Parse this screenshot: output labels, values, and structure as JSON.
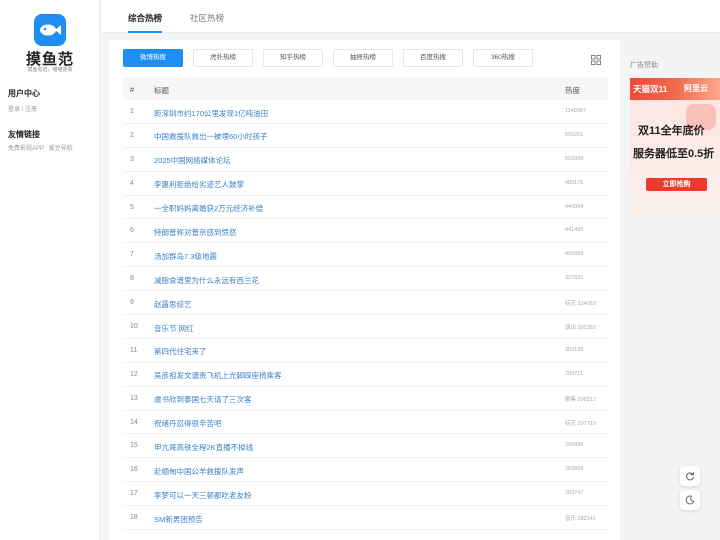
{
  "brand": {
    "name": "摸鱼范",
    "tagline": "摸鱼有范，喵喵更高"
  },
  "sidebar": {
    "user_center": "用户中心",
    "login": "登录",
    "separator": "/",
    "register": "注册",
    "links_title": "友情链接",
    "links": [
      "免费影视APP",
      "爱豆导航"
    ]
  },
  "top_tabs": [
    {
      "label": "综合热榜",
      "active": true
    },
    {
      "label": "社区热榜",
      "active": false
    }
  ],
  "source_tabs": [
    {
      "label": "微博热搜",
      "active": true
    },
    {
      "label": "虎扑热榜",
      "active": false
    },
    {
      "label": "知乎热榜",
      "active": false
    },
    {
      "label": "抽屉热榜",
      "active": false
    },
    {
      "label": "百度热搜",
      "active": false
    },
    {
      "label": "360热搜",
      "active": false
    }
  ],
  "table": {
    "headers": {
      "num": "#",
      "title": "标题",
      "heat": "热度"
    },
    "rows": [
      {
        "num": "1",
        "title": "距深圳市约170公里发现1亿吨油田",
        "heat": "1140387"
      },
      {
        "num": "2",
        "title": "中国救援队救出一被埋60小时孩子",
        "heat": "599201"
      },
      {
        "num": "3",
        "title": "2025中国网络媒体论坛",
        "heat": "502009"
      },
      {
        "num": "4",
        "title": "李惠利拒绝给劣迹艺人鼓掌",
        "heat": "485176"
      },
      {
        "num": "5",
        "title": "一全职妈妈离婚获2万元经济补偿",
        "heat": "444364"
      },
      {
        "num": "6",
        "title": "特朗普称对普京感到愤怒",
        "heat": "441455"
      },
      {
        "num": "7",
        "title": "汤加群岛7.3级地震",
        "heat": "405668"
      },
      {
        "num": "8",
        "title": "减脂食谱里为什么永远有西兰花",
        "heat": "327831"
      },
      {
        "num": "9",
        "title": "赵露思综艺",
        "heat": "综艺 314063"
      },
      {
        "num": "10",
        "title": "音乐节 网红",
        "heat": "演出 302383"
      },
      {
        "num": "11",
        "title": "第四代住宅来了",
        "heat": "302128"
      },
      {
        "num": "12",
        "title": "吴彦祖发文谴责飞机上光脚踩座椅乘客",
        "heat": "299711"
      },
      {
        "num": "13",
        "title": "虞书欣到泰国七天请了三次客",
        "heat": "剧集 298312"
      },
      {
        "num": "14",
        "title": "祝绪丹忍得很辛苦吧",
        "heat": "综艺 297719"
      },
      {
        "num": "15",
        "title": "甲亢哥高铁全程2K直播不掉线",
        "heat": "296895"
      },
      {
        "num": "16",
        "title": "赴缅甸中国公羊救援队发声",
        "heat": "283868"
      },
      {
        "num": "17",
        "title": "李梦可以一天三顿都吃老友粉",
        "heat": "263747"
      },
      {
        "num": "18",
        "title": "SM新男团预告",
        "heat": "音乐 282141"
      }
    ]
  },
  "ad": {
    "label": "广告赞助",
    "brand_left": "天猫双11",
    "brand_right": "阿里云",
    "line1": "双11全年底价",
    "line2": "服务器低至0.5折",
    "button": "立即抢购"
  },
  "colors": {
    "accent": "#1e8ef5",
    "link": "#3b82c4",
    "ad_red": "#ec3b2c"
  },
  "icons": [
    "fish-logo-icon",
    "grid-icon",
    "refresh-icon",
    "dark-mode-icon"
  ]
}
